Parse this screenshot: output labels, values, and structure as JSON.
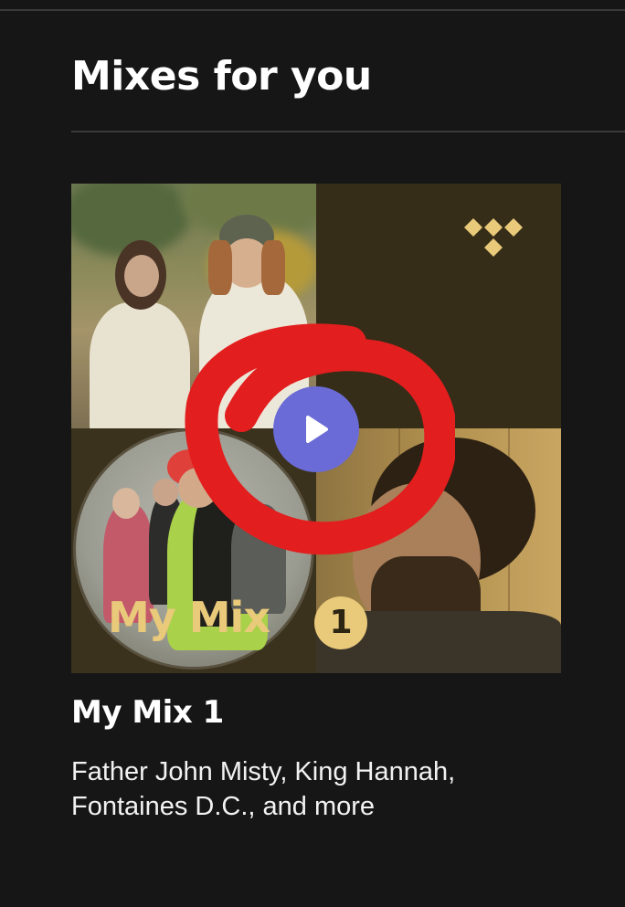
{
  "section": {
    "title": "Mixes for you"
  },
  "mix": {
    "title": "My Mix 1",
    "subtitle_line1": "Father John Misty, King Hannah,",
    "subtitle_line2": "Fontaines D.C., and more",
    "cover_label": "My Mix",
    "cover_number": "1",
    "play_icon": "play-icon",
    "brand_icon": "tidal-logo-icon"
  },
  "colors": {
    "background": "#161616",
    "cover_text": "#e9c97a",
    "play_button": "#6a6bd6",
    "annotation": "#e31e1e"
  }
}
